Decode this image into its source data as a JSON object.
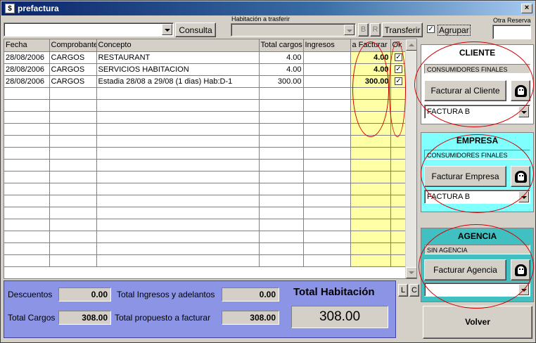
{
  "window": {
    "title": "prefactura",
    "icon": "dollar-icon",
    "close": "×"
  },
  "toolbar": {
    "search_value": "",
    "consulta_label": "Consulta",
    "habitacion_label": "Habitación a trasferir",
    "habitacion_value": "",
    "b_label": "B",
    "r_label": "R",
    "transferir_label": "Transferir",
    "agrupar_label": "Agrupar",
    "agrupar_checked": true,
    "otra_reserva_label": "Otra Reserva",
    "otra_reserva_value": ""
  },
  "grid": {
    "columns": [
      "Fecha",
      "Comprobante",
      "Concepto",
      "Total cargos",
      "Ingresos",
      "a Facturar",
      "Ok"
    ],
    "rows": [
      {
        "fecha": "28/08/2006",
        "comprobante": "CARGOS",
        "concepto": "RESTAURANT",
        "total": "4.00",
        "ingresos": "",
        "facturar": "4.00",
        "ok": true
      },
      {
        "fecha": "28/08/2006",
        "comprobante": "CARGOS",
        "concepto": "SERVICIOS HABITACION",
        "total": "4.00",
        "ingresos": "",
        "facturar": "4.00",
        "ok": true
      },
      {
        "fecha": "28/08/2006",
        "comprobante": "CARGOS",
        "concepto": "Estadia 28/08 a 29/08 (1 dias) Hab:D-1",
        "total": "300.00",
        "ingresos": "",
        "facturar": "300.00",
        "ok": true
      }
    ],
    "empty_rows": 15
  },
  "side": {
    "cliente": {
      "title": "CLIENTE",
      "sub": "CONSUMIDORES FINALES",
      "button": "Facturar al Cliente",
      "select": "FACTURA B",
      "bg": "#ffffff"
    },
    "empresa": {
      "title": "EMPRESA",
      "sub": "CONSUMIDORES FINALES",
      "button": "Facturar Empresa",
      "select": "FACTURA B",
      "bg": "#80ffff"
    },
    "agencia": {
      "title": "AGENCIA",
      "sub": "SIN AGENCIA",
      "button": "Facturar Agencia",
      "select": "",
      "bg": "#40c0c0"
    }
  },
  "summary": {
    "descuentos_label": "Descuentos",
    "descuentos_value": "0.00",
    "ingresos_label": "Total Ingresos y adelantos",
    "ingresos_value": "0.00",
    "cargos_label": "Total Cargos",
    "cargos_value": "308.00",
    "propuesto_label": "Total  propuesto a facturar",
    "propuesto_value": "308.00",
    "habitacion_title": "Total Habitación",
    "habitacion_value": "308.00",
    "l_label": "L",
    "c_label": "C"
  },
  "volver_label": "Volver",
  "colors": {
    "summary_bg": "#8c94e6",
    "facturar_bg": "#ffffa6",
    "annotation": "#d40000",
    "title_bar": "#0a246a"
  }
}
